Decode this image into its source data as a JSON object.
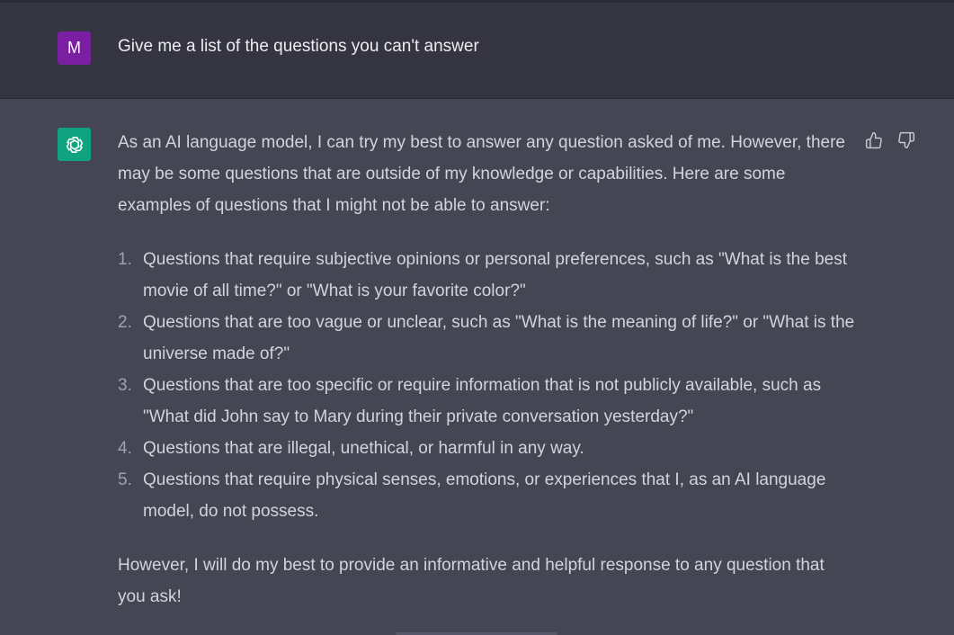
{
  "user_message": {
    "avatar_letter": "M",
    "text": "Give me a list of the questions you can't answer"
  },
  "assistant_message": {
    "intro": "As an AI language model, I can try my best to answer any question asked of me. However, there may be some questions that are outside of my knowledge or capabilities. Here are some examples of questions that I might not be able to answer:",
    "items": [
      {
        "number": "1.",
        "text": "Questions that require subjective opinions or personal preferences, such as \"What is the best movie of all time?\" or \"What is your favorite color?\""
      },
      {
        "number": "2.",
        "text": "Questions that are too vague or unclear, such as \"What is the meaning of life?\" or \"What is the universe made of?\""
      },
      {
        "number": "3.",
        "text": "Questions that are too specific or require information that is not publicly available, such as \"What did John say to Mary during their private conversation yesterday?\""
      },
      {
        "number": "4.",
        "text": "Questions that are illegal, unethical, or harmful in any way."
      },
      {
        "number": "5.",
        "text": "Questions that require physical senses, emotions, or experiences that I, as an AI language model, do not possess."
      }
    ],
    "closing": "However, I will do my best to provide an informative and helpful response to any question that you ask!"
  },
  "icons": {
    "bot_avatar": "openai-logo-icon",
    "thumbs_up": "thumbs-up-icon",
    "thumbs_down": "thumbs-down-icon"
  },
  "colors": {
    "user_row_bg": "#343541",
    "assistant_row_bg": "#444654",
    "user_avatar_bg": "#7b1fa2",
    "bot_avatar_bg": "#10a37f"
  }
}
